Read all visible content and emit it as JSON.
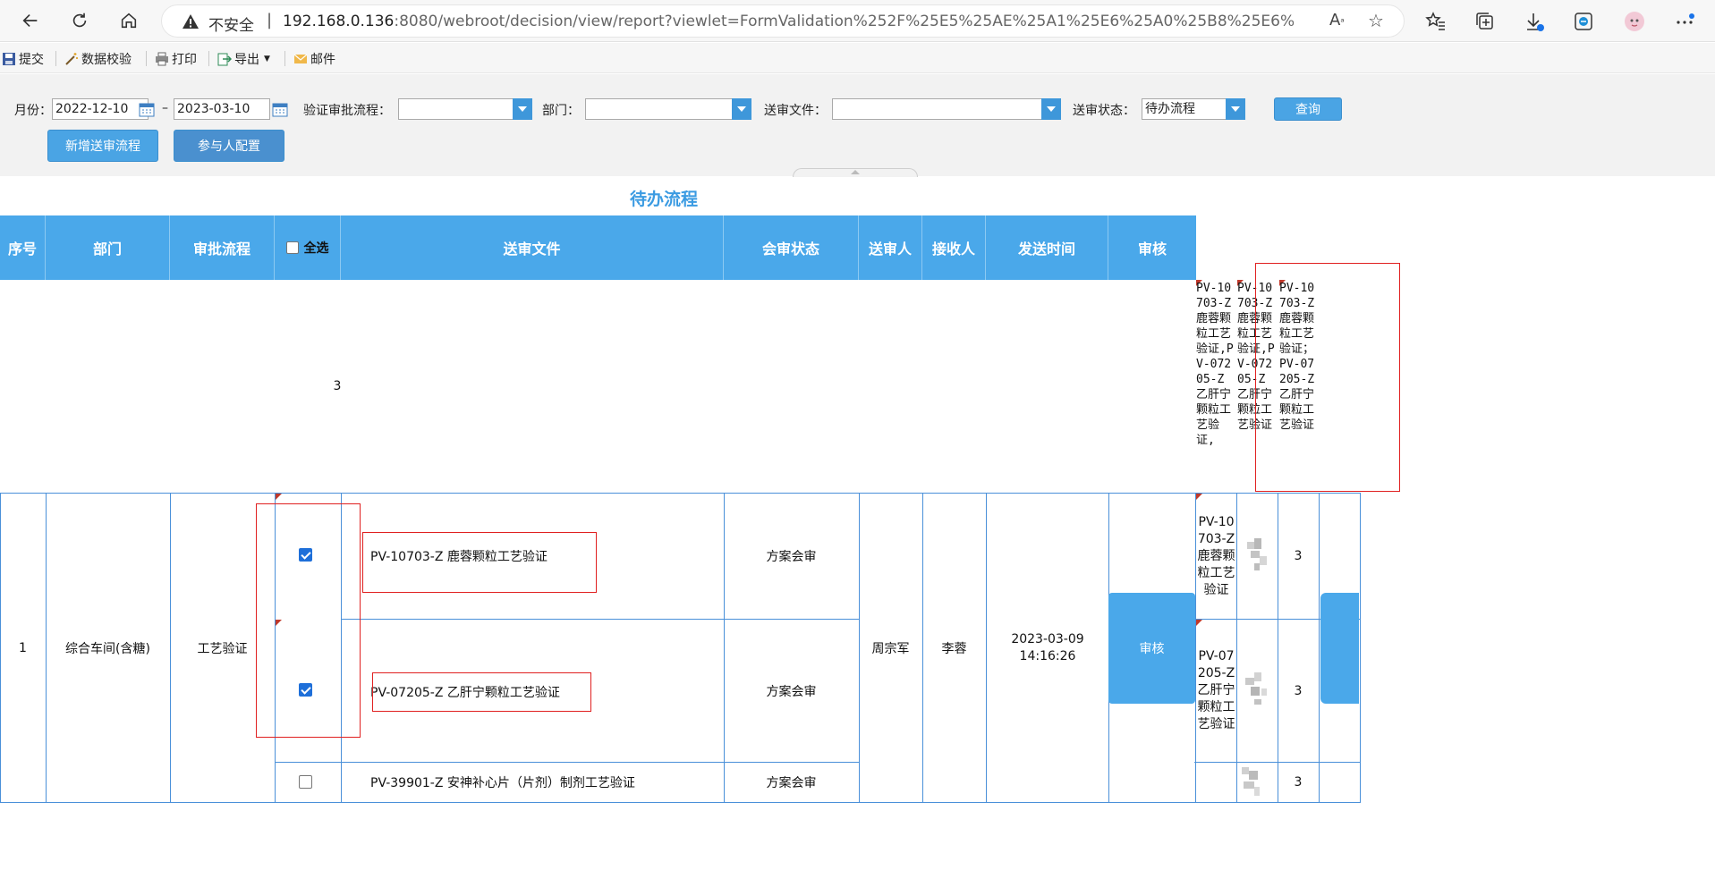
{
  "browser": {
    "security_label": "不安全",
    "separator": "|",
    "url_host": "192.168.0.136",
    "url_rest": ":8080/webroot/decision/view/report?viewlet=FormValidation%252F%25E5%25AE%25A1%25E6%25A0%25B8%25E6%25B5%2581%25E..."
  },
  "toolbar": {
    "submit": "提交",
    "validate": "数据校验",
    "print": "打印",
    "export": "导出",
    "mail": "邮件"
  },
  "filters": {
    "month_label": "月份：",
    "date_from": "2022-12-10",
    "range_sep": "–",
    "date_to": "2023-03-10",
    "flow_label": "验证审批流程：",
    "flow_value": "",
    "dept_label": "部门：",
    "dept_value": "",
    "doc_label": "送审文件：",
    "doc_value": "",
    "status_label": "送审状态：",
    "status_value": "待办流程",
    "query_button": "查询",
    "add_flow_button": "新增送审流程",
    "participant_button": "参与人配置"
  },
  "report": {
    "title": "待办流程",
    "headers": {
      "seq": "序号",
      "dept": "部门",
      "flow": "审批流程",
      "select_all": "全选",
      "doc": "送审文件",
      "status": "会审状态",
      "sender": "送审人",
      "receiver": "接收人",
      "time": "发送时间",
      "review": "审核"
    },
    "summary_count": "3",
    "overflow_texts": [
      "PV-10703-Z 鹿蓉颗粒工艺验证,PV-07205-Z 乙肝宁颗粒工艺验证,",
      "PV-10703-Z 鹿蓉颗粒工艺验证,PV-07205-Z 乙肝宁颗粒工艺验证",
      "PV-10703-Z 鹿蓉颗粒工艺验证；PV-07205-Z 乙肝宁颗粒工艺验证"
    ],
    "group": {
      "seq": "1",
      "dept": "综合车间(含糖)",
      "flow": "工艺验证",
      "sender": "周宗军",
      "receiver": "李蓉",
      "time": "2023-03-09 14:16:26",
      "review_button": "审核"
    },
    "rows": [
      {
        "checked": true,
        "doc": "PV-10703-Z 鹿蓉颗粒工艺验证",
        "status": "方案会审",
        "side_doc": "PV-10703-Z 鹿蓉颗粒工艺验证",
        "count": "3"
      },
      {
        "checked": true,
        "doc": "PV-07205-Z 乙肝宁颗粒工艺验证",
        "status": "方案会审",
        "side_doc": "PV-07205-Z 乙肝宁颗粒工艺验证",
        "count": "3"
      },
      {
        "checked": false,
        "doc": "PV-39901-Z 安神补心片（片剂）制剂工艺验证",
        "status": "方案会审",
        "side_doc": "",
        "count": "3"
      }
    ]
  },
  "colors": {
    "header_blue": "#4aa8ea",
    "title_blue": "#3b9be2",
    "grid_blue": "#4a90d9",
    "highlight_red": "#e02020"
  }
}
